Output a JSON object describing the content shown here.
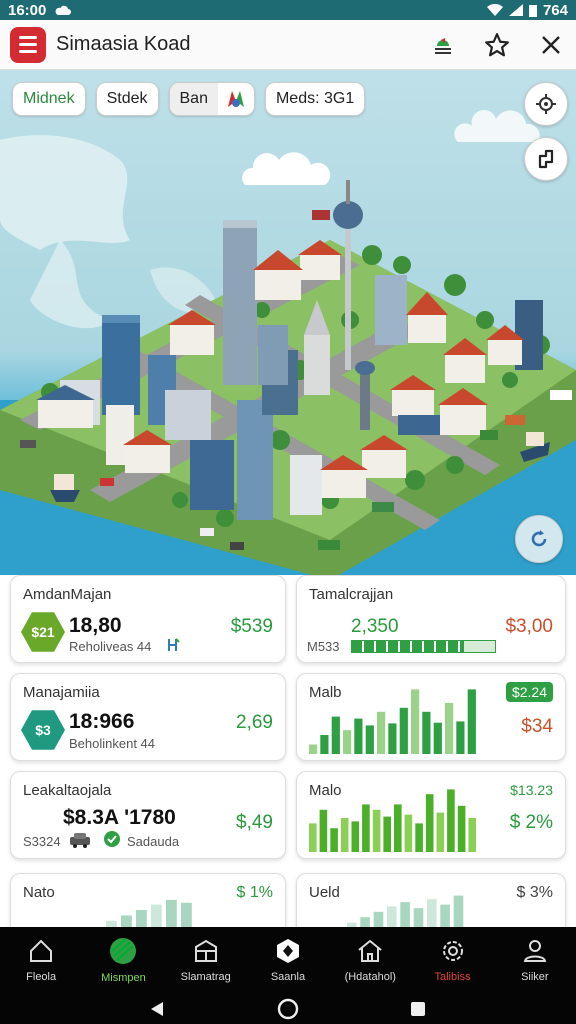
{
  "status": {
    "time": "16:00",
    "battery": "764"
  },
  "appbar": {
    "title": "Simaasia Koad"
  },
  "chips": [
    {
      "label": "Midnek"
    },
    {
      "label": "Stdek"
    },
    {
      "label": "Ban"
    },
    {
      "label": "Meds: 3G1"
    }
  ],
  "cards": {
    "c1": {
      "title": "AmdanMajan",
      "badge": "$21",
      "value": "18,80",
      "sub": "Reholiveas 44",
      "amount": "$539"
    },
    "c2": {
      "title": "Tamalcrajjan",
      "value": "2,350",
      "amount": "$3,00",
      "sub": "M533",
      "progress": 0.78
    },
    "c3": {
      "title": "Manajamiia",
      "badge": "$3",
      "value": "18:966",
      "sub": "Beholinkent 44",
      "amount": "2,69"
    },
    "c4": {
      "title": "Malb",
      "badge": "$2.24",
      "amount": "$34",
      "bars": [
        0.14,
        0.28,
        0.55,
        0.35,
        0.52,
        0.42,
        0.62,
        0.45,
        0.68,
        0.95,
        0.62,
        0.46,
        0.75,
        0.48,
        0.95
      ]
    },
    "c5": {
      "title": "Leakaltaojala",
      "value": "$8.3A '1780",
      "sub1": "S3324",
      "sub2": "Sadauda",
      "amount": "$,49"
    },
    "c6": {
      "title": "Malo",
      "badge": "$13.23",
      "amount": "$ 2%",
      "bars": [
        0.42,
        0.62,
        0.35,
        0.5,
        0.45,
        0.7,
        0.62,
        0.52,
        0.7,
        0.55,
        0.42,
        0.85,
        0.58,
        0.92,
        0.68,
        0.5
      ]
    },
    "c7": {
      "title": "Nato",
      "amount": "$ 1%",
      "bars": [
        0.2,
        0.35,
        0.5,
        0.65,
        0.78,
        0.7
      ]
    },
    "c8": {
      "title": "Ueld",
      "amount": "$ 3%",
      "bars": [
        0.15,
        0.3,
        0.45,
        0.6,
        0.72,
        0.55,
        0.8,
        0.65,
        0.9
      ]
    }
  },
  "nav": [
    {
      "label": "Fleola"
    },
    {
      "label": "Mismpen"
    },
    {
      "label": "Slamatrag"
    },
    {
      "label": "Saanla"
    },
    {
      "label": "(Hdatahol)"
    },
    {
      "label": "Talibiss"
    },
    {
      "label": "Siiker"
    }
  ],
  "colors": {
    "accent_green": "#2a9a3d",
    "accent_red": "#d42a32",
    "teal": "#1f6b73"
  }
}
